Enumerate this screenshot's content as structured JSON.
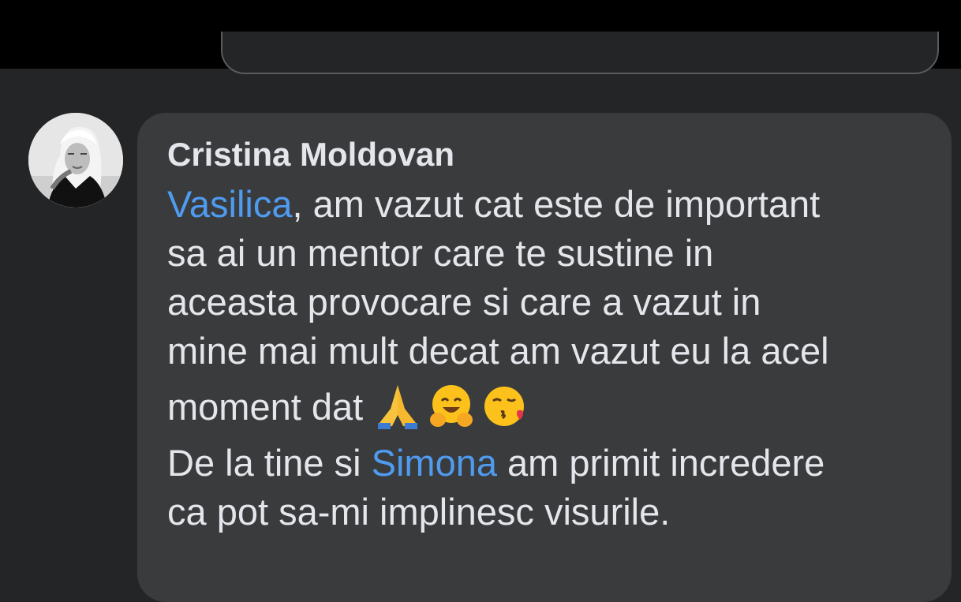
{
  "comment": {
    "author": "Cristina Moldovan",
    "mentions": {
      "first": "Vasilica",
      "second": "Simona"
    },
    "lines": {
      "l1_rest": ", am vazut cat este de important",
      "l2": "sa ai un mentor care te sustine in",
      "l3": "aceasta provocare si care a vazut in",
      "l4": "mine mai mult decat am vazut eu la acel",
      "l5": "moment dat ",
      "l6_pre": "De la tine si ",
      "l6_post": " am primit incredere",
      "l7": "ca pot sa-mi implinesc visurile."
    },
    "emojis": [
      "folded-hands-icon",
      "hugging-face-icon",
      "face-blowing-kiss-icon"
    ]
  },
  "colors": {
    "background": "#242526",
    "bubble": "#3a3b3c",
    "text": "#e4e6eb",
    "mention": "#4f9bf0"
  }
}
